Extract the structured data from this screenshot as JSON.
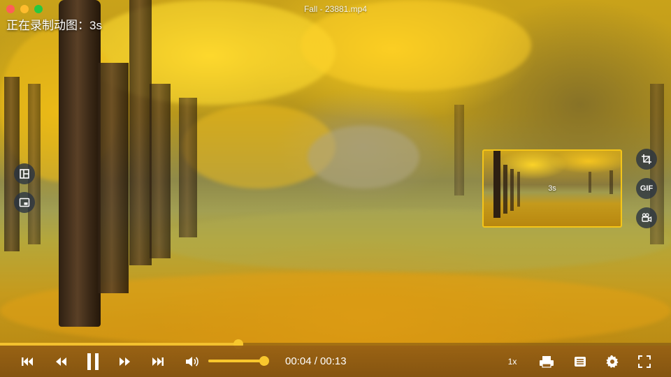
{
  "window": {
    "title": "Fall - 23881.mp4"
  },
  "recording": {
    "status_text": "正在录制动图：3s"
  },
  "gif_preview": {
    "duration_label": "3s"
  },
  "side_tools_left": [
    {
      "icon": "layout-grid-icon"
    },
    {
      "icon": "picture-in-picture-icon"
    }
  ],
  "side_tools_right": [
    {
      "icon": "crop-icon"
    },
    {
      "icon": "gif-icon",
      "label": "GIF"
    },
    {
      "icon": "video-camera-icon"
    }
  ],
  "playback": {
    "current_time": "00:04",
    "total_time": "00:13",
    "time_display": "00:04 / 00:13",
    "progress_fraction": 0.355,
    "volume_fraction": 1.0,
    "speed_label": "1x",
    "state": "playing"
  },
  "colors": {
    "accent": "#f8c72d",
    "control_bar": "#96601a",
    "preview_border": "#f5c518"
  }
}
